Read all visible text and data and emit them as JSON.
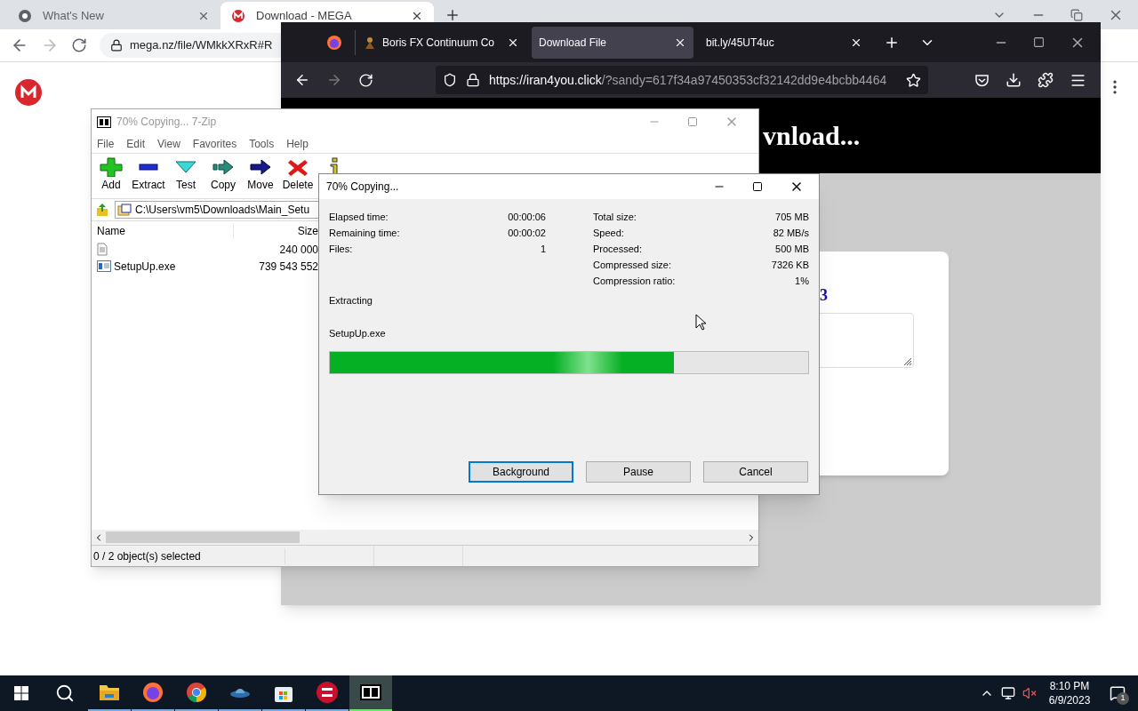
{
  "chrome": {
    "tabs": [
      {
        "title": "What's New",
        "selected": false
      },
      {
        "title": "Download - MEGA",
        "selected": true
      }
    ],
    "url": "mega.nz/file/WMkkXRxR#R"
  },
  "firefox": {
    "tabs": [
      {
        "title": "Boris FX Continuum Co",
        "selected": false
      },
      {
        "title": "Download File",
        "selected": true
      },
      {
        "title": "bit.ly/45UT4uc",
        "selected": false
      }
    ],
    "url_host": "https://iran4you.click",
    "url_rest": "/?sandy=617f34a97450353cf32142dd9e4bcbb4464",
    "heading": "vnload...",
    "card_link": "3"
  },
  "sevenzip": {
    "title": "70% Copying... 7-Zip",
    "menu": [
      "File",
      "Edit",
      "View",
      "Favorites",
      "Tools",
      "Help"
    ],
    "toolbar": [
      {
        "kind": "add",
        "label": "Add"
      },
      {
        "kind": "extract",
        "label": "Extract"
      },
      {
        "kind": "test",
        "label": "Test"
      },
      {
        "kind": "copy",
        "label": "Copy"
      },
      {
        "kind": "move",
        "label": "Move"
      },
      {
        "kind": "delete",
        "label": "Delete"
      },
      {
        "kind": "info"
      }
    ],
    "path": "C:\\Users\\vm5\\Downloads\\Main_Setu",
    "columns": [
      "Name",
      "Size"
    ],
    "rows": [
      {
        "kind": "doc",
        "size": "240 000"
      },
      {
        "kind": "exe",
        "name": "SetupUp.exe",
        "size": "739 543 552"
      }
    ],
    "status": "0 / 2 object(s) selected"
  },
  "dialog": {
    "title": "70% Copying...",
    "stats_left": [
      {
        "label": "Elapsed time:",
        "value": "00:00:06"
      },
      {
        "label": "Remaining time:",
        "value": "00:00:02"
      },
      {
        "label": "Files:",
        "value": "1"
      }
    ],
    "stats_right": [
      {
        "label": "Total size:",
        "value": "705 MB"
      },
      {
        "label": "Speed:",
        "value": "82 MB/s"
      },
      {
        "label": "Processed:",
        "value": "500 MB"
      },
      {
        "label": "Compressed size:",
        "value": "7326 KB"
      },
      {
        "label": "Compression ratio:",
        "value": "1%"
      }
    ],
    "operation": "Extracting",
    "file": "SetupUp.exe",
    "level": 0.72,
    "buttons": [
      {
        "label": "Background",
        "focused": true
      },
      {
        "label": "Pause",
        "focused": false
      },
      {
        "label": "Cancel",
        "focused": false
      }
    ]
  },
  "taskbar": {
    "apps": [
      {
        "kind": "explorer",
        "selected": false
      },
      {
        "kind": "firefox",
        "selected": false
      },
      {
        "kind": "chrome",
        "selected": false
      },
      {
        "kind": "ufo",
        "selected": false
      },
      {
        "kind": "store",
        "selected": false
      },
      {
        "kind": "devcpp",
        "selected": false
      },
      {
        "kind": "sevenzip",
        "selected": true
      }
    ],
    "time": "8:10 PM",
    "date": "6/9/2023",
    "notifications": "1"
  }
}
